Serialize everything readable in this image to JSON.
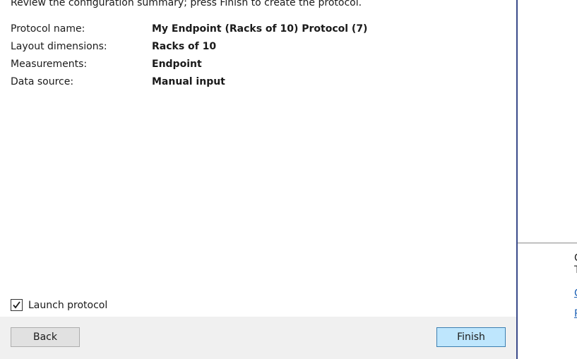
{
  "intro_text": "Review the configuration summary; press Finish to create the protocol.",
  "summary": [
    {
      "label": "Protocol name:",
      "value": "My Endpoint (Racks of 10) Protocol (7)"
    },
    {
      "label": "Layout dimensions:",
      "value": "Racks of 10"
    },
    {
      "label": "Measurements:",
      "value": "Endpoint"
    },
    {
      "label": "Data source:",
      "value": "Manual input"
    }
  ],
  "launch": {
    "label": "Launch protocol",
    "checked": true
  },
  "buttons": {
    "back": "Back",
    "finish": "Finish"
  },
  "side_panel": {
    "truncated_text_1": "C",
    "truncated_text_2": "T",
    "truncated_link_1": "C",
    "truncated_link_2": "R"
  },
  "colors": {
    "divider": "#3a4a8a",
    "finish_bg": "#bee6fd",
    "footer_bg": "#f0f0f0",
    "link": "#1a5fb4"
  }
}
